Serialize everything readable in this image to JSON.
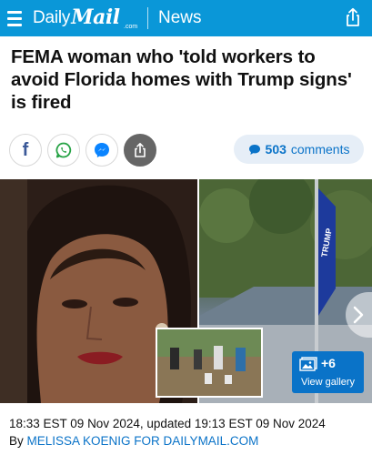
{
  "header": {
    "logo_daily": "Daily",
    "logo_mail": "Mail",
    "logo_com": ".com",
    "section": "News",
    "menu_icon": "hamburger-menu-icon",
    "share_icon": "share-icon",
    "bg_color": "#0a97d8"
  },
  "article": {
    "headline": "FEMA woman who 'told workers to avoid Florida homes with Trump signs' is fired",
    "dateline": "18:33 EST 09 Nov 2024, updated 19:13 EST 09 Nov 2024",
    "byline_prefix": "By ",
    "byline_author": "MELISSA KOENIG FOR DAILYMAIL.COM"
  },
  "social": {
    "buttons": [
      {
        "icon": "facebook-icon",
        "label": "f"
      },
      {
        "icon": "whatsapp-icon"
      },
      {
        "icon": "messenger-icon"
      },
      {
        "icon": "share-icon"
      }
    ],
    "comments_count": "503",
    "comments_label": "comments",
    "comments_icon": "speech-bubble-icon"
  },
  "gallery": {
    "count": "+6",
    "label": "View gallery",
    "icon": "gallery-icon",
    "next_icon": "chevron-right-icon",
    "flag_text": "TRUMP"
  }
}
